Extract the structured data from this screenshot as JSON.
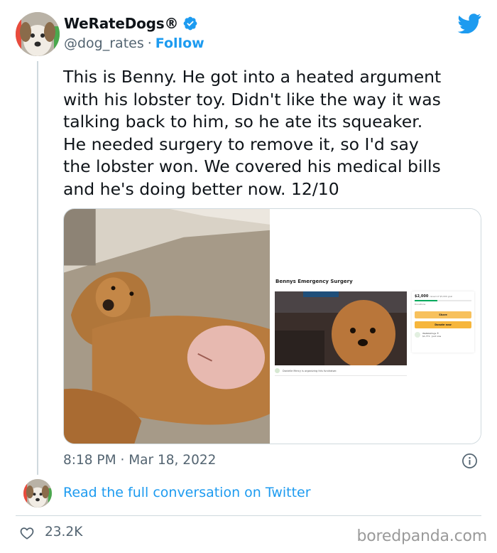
{
  "author": {
    "display_name": "WeRateDogs®",
    "handle": "@dog_rates",
    "separator": "·",
    "follow_label": "Follow",
    "verified": true
  },
  "tweet": {
    "text": "This is Benny. He got into a heated argument\nwith his lobster toy. Didn't like the way it was\ntalking back to him, so he ate its squeaker.\nHe needed surgery to remove it, so I'd say\nthe lobster won. We covered his medical bills\nand he's doing better now. 12/10",
    "time": "8:18 PM",
    "date_separator": "·",
    "date": "Mar 18, 2022"
  },
  "fundraiser_screenshot": {
    "title": "Bennys Emergency Surgery",
    "raised": "$2,000",
    "goal_text": "raised of $5,000 goal",
    "progress_fraction": 0.4,
    "donations_text": "Donations",
    "share_label": "Share",
    "donate_label": "Donate now",
    "donor_name": "WeRateDogs ®",
    "donor_amount": "$1,771 · Just now",
    "organizer_text": "Danielle Mercy is organizing this fundraiser."
  },
  "conversation_link": "Read the full conversation on Twitter",
  "likes": "23.2K",
  "watermark": "boredpanda.com",
  "icons": {
    "platform": "twitter-bird-icon",
    "verified": "verified-badge-icon",
    "info": "info-icon",
    "like": "heart-icon"
  },
  "colors": {
    "accent": "#1d9bf0",
    "text": "#0f1419",
    "muted": "#536471",
    "divider": "#cfd9de",
    "watermark": "#9a9a9a"
  }
}
